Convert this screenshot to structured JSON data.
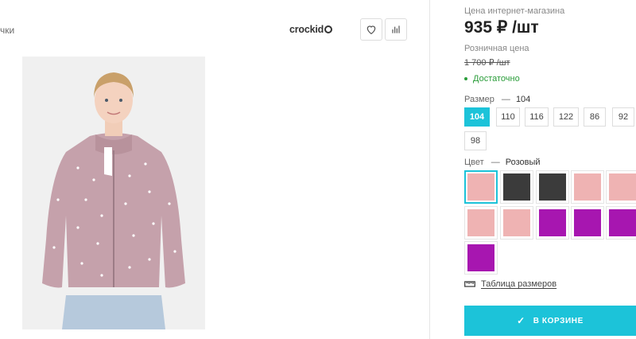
{
  "breadcrumb": {
    "tail": "чки"
  },
  "brand": {
    "logo_text": "crockid"
  },
  "product": {
    "price_label": "Цена интернет-магазина",
    "price": "935 ₽ /шт",
    "retail_label": "Розничная цена",
    "retail_price": "1 700 ₽ /шт",
    "stock_status": "Достаточно",
    "size": {
      "label": "Размер",
      "separator": "—",
      "selected": "104",
      "options": [
        "104",
        "110",
        "116",
        "122",
        "86",
        "92",
        "98"
      ]
    },
    "color": {
      "label": "Цвет",
      "separator": "—",
      "selected": "Розовый",
      "swatches": [
        "#efb3b3",
        "#3b3b3b",
        "#3b3b3b",
        "#efb3b3",
        "#efb3b3",
        "#efb3b3",
        "#efb3b3",
        "#a716b0",
        "#a716b0",
        "#a716b0",
        "#a716b0"
      ]
    },
    "size_table_link": "Таблица размеров",
    "cart_button": "В КОРЗИНЕ"
  },
  "icons": {
    "favorite": "heart-icon",
    "compare": "bar-chart-icon",
    "size_table": "ruler-icon",
    "cart": "check-icon"
  }
}
